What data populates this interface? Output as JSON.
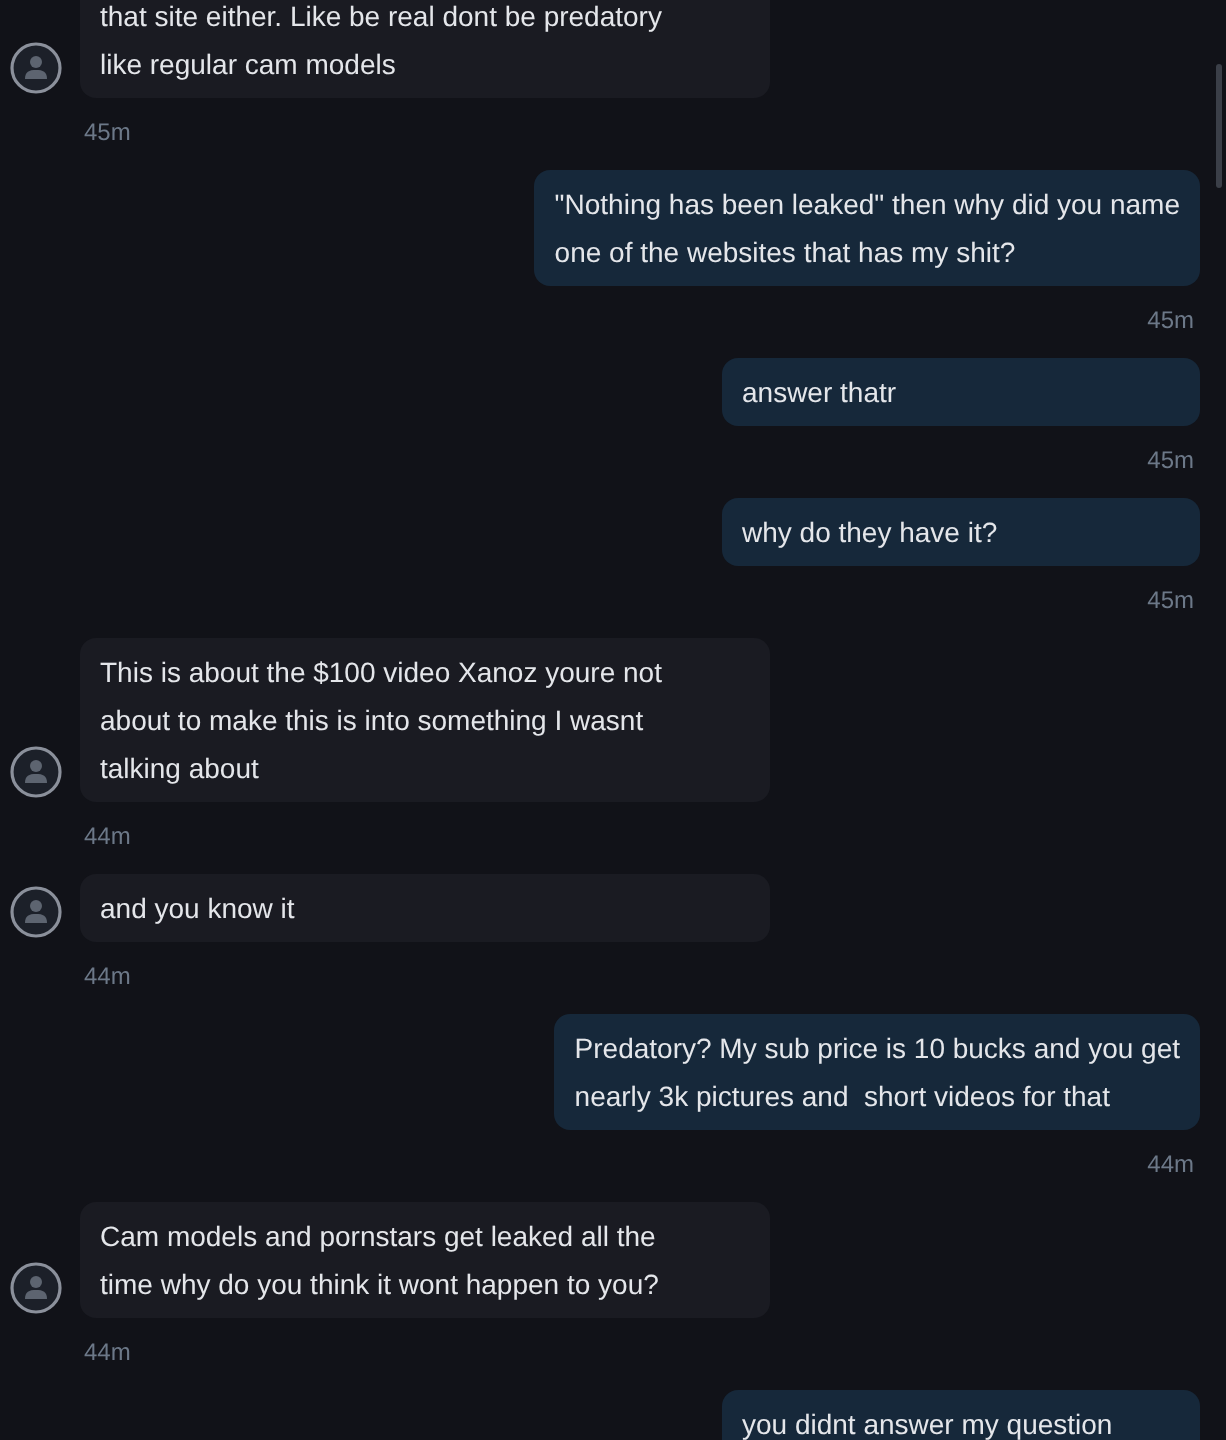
{
  "messages": [
    {
      "kind": "received",
      "text": "that site either. Like be real dont be predatory\nlike regular cam models",
      "time": "45m"
    },
    {
      "kind": "sent",
      "text": "\"Nothing has been leaked\" then why did you name\none of the websites that has my shit?",
      "time": "45m"
    },
    {
      "kind": "sent",
      "text": "answer thatr",
      "time": "45m"
    },
    {
      "kind": "sent",
      "text": "why do they have it?",
      "time": "45m"
    },
    {
      "kind": "received",
      "text": "This is about the $100 video Xanoz youre not\nabout to make this is into something I wasnt\ntalking about",
      "time": "44m"
    },
    {
      "kind": "received",
      "text": "and you know it",
      "time": "44m"
    },
    {
      "kind": "sent",
      "text": "Predatory? My sub price is 10 bucks and you get\nnearly 3k pictures and  short videos for that",
      "time": "44m"
    },
    {
      "kind": "received",
      "text": "Cam models and pornstars get leaked all the\ntime why do you think it wont happen to you?",
      "time": "44m"
    },
    {
      "kind": "sent",
      "text": "you didnt answer my question"
    }
  ]
}
